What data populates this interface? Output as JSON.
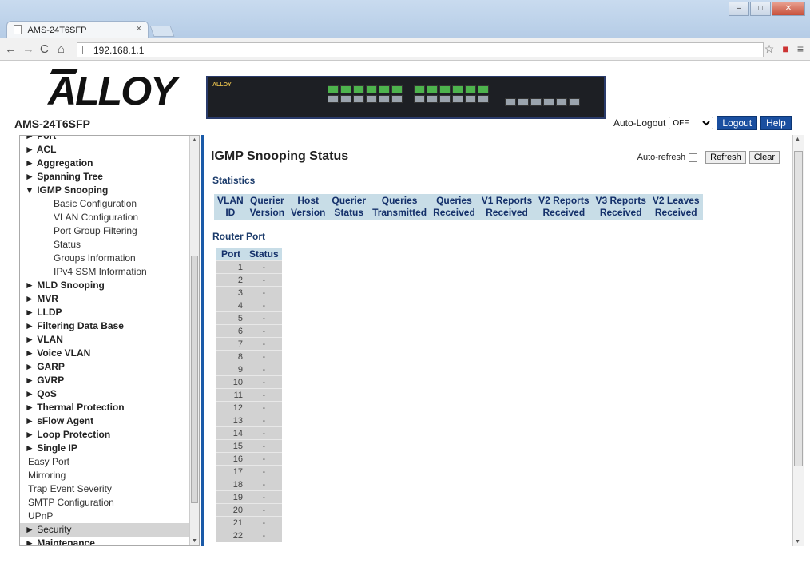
{
  "browser": {
    "tab_title": "AMS-24T6SFP",
    "tab_close": "×",
    "url": "192.168.1.1"
  },
  "brand": {
    "logo_text": "ALLOY",
    "model": "AMS-24T6SFP"
  },
  "topbar": {
    "auto_logout_label": "Auto-Logout",
    "auto_logout_value": "OFF",
    "logout_label": "Logout",
    "help_label": "Help"
  },
  "menu": {
    "items": [
      {
        "label": "► Port",
        "type": "h"
      },
      {
        "label": "► ACL",
        "type": "h"
      },
      {
        "label": "► Aggregation",
        "type": "h"
      },
      {
        "label": "► Spanning Tree",
        "type": "h"
      },
      {
        "label": "▼ IGMP Snooping",
        "type": "h"
      },
      {
        "label": "Basic Configuration",
        "type": "s"
      },
      {
        "label": "VLAN Configuration",
        "type": "s"
      },
      {
        "label": "Port Group Filtering",
        "type": "s"
      },
      {
        "label": "Status",
        "type": "s"
      },
      {
        "label": "Groups Information",
        "type": "s"
      },
      {
        "label": "IPv4 SSM Information",
        "type": "s"
      },
      {
        "label": "► MLD Snooping",
        "type": "h"
      },
      {
        "label": "► MVR",
        "type": "h"
      },
      {
        "label": "► LLDP",
        "type": "h"
      },
      {
        "label": "► Filtering Data Base",
        "type": "h"
      },
      {
        "label": "► VLAN",
        "type": "h"
      },
      {
        "label": "► Voice VLAN",
        "type": "h"
      },
      {
        "label": "► GARP",
        "type": "h"
      },
      {
        "label": "► GVRP",
        "type": "h"
      },
      {
        "label": "► QoS",
        "type": "h"
      },
      {
        "label": "► Thermal Protection",
        "type": "h"
      },
      {
        "label": "► sFlow Agent",
        "type": "h"
      },
      {
        "label": "► Loop Protection",
        "type": "h"
      },
      {
        "label": "► Single IP",
        "type": "h"
      },
      {
        "label": "Easy Port",
        "type": "p"
      },
      {
        "label": "Mirroring",
        "type": "p"
      },
      {
        "label": "Trap Event Severity",
        "type": "p"
      },
      {
        "label": "SMTP Configuration",
        "type": "p"
      },
      {
        "label": "UPnP",
        "type": "p"
      },
      {
        "label": "► Security",
        "type": "sec"
      },
      {
        "label": "► Maintenance",
        "type": "h"
      }
    ]
  },
  "main": {
    "title": "IGMP Snooping Status",
    "auto_refresh_label": "Auto-refresh",
    "refresh_label": "Refresh",
    "clear_label": "Clear",
    "statistics_heading": "Statistics",
    "statistics_columns": [
      [
        "VLAN",
        "ID"
      ],
      [
        "Querier",
        "Version"
      ],
      [
        "Host",
        "Version"
      ],
      [
        "Querier",
        "Status"
      ],
      [
        "Queries",
        "Transmitted"
      ],
      [
        "Queries",
        "Received"
      ],
      [
        "V1 Reports",
        "Received"
      ],
      [
        "V2 Reports",
        "Received"
      ],
      [
        "V3 Reports",
        "Received"
      ],
      [
        "V2 Leaves",
        "Received"
      ]
    ],
    "router_port_heading": "Router Port",
    "router_port_columns": [
      "Port",
      "Status"
    ],
    "router_ports": [
      {
        "port": "1",
        "status": "-"
      },
      {
        "port": "2",
        "status": "-"
      },
      {
        "port": "3",
        "status": "-"
      },
      {
        "port": "4",
        "status": "-"
      },
      {
        "port": "5",
        "status": "-"
      },
      {
        "port": "6",
        "status": "-"
      },
      {
        "port": "7",
        "status": "-"
      },
      {
        "port": "8",
        "status": "-"
      },
      {
        "port": "9",
        "status": "-"
      },
      {
        "port": "10",
        "status": "-"
      },
      {
        "port": "11",
        "status": "-"
      },
      {
        "port": "12",
        "status": "-"
      },
      {
        "port": "13",
        "status": "-"
      },
      {
        "port": "14",
        "status": "-"
      },
      {
        "port": "15",
        "status": "-"
      },
      {
        "port": "16",
        "status": "-"
      },
      {
        "port": "17",
        "status": "-"
      },
      {
        "port": "18",
        "status": "-"
      },
      {
        "port": "19",
        "status": "-"
      },
      {
        "port": "20",
        "status": "-"
      },
      {
        "port": "21",
        "status": "-"
      },
      {
        "port": "22",
        "status": "-"
      }
    ]
  },
  "colors": {
    "accent": "#1a5aa8",
    "table_header": "#c8dde7"
  }
}
